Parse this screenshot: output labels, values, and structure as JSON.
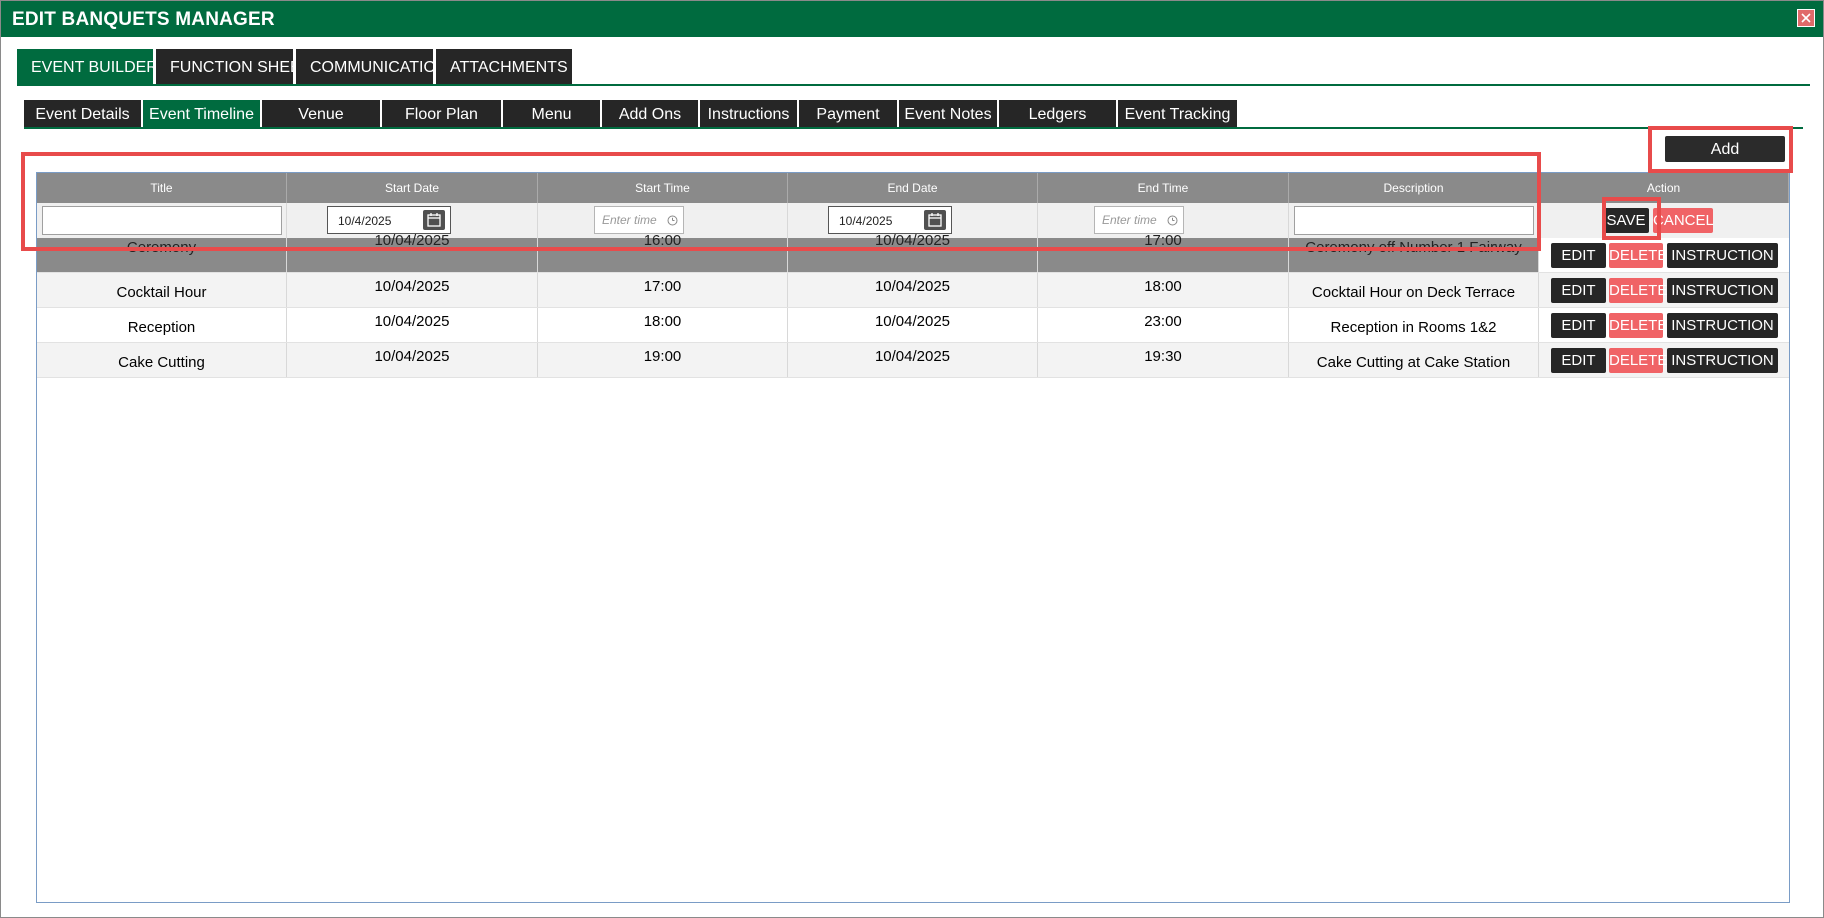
{
  "window": {
    "title": "EDIT BANQUETS MANAGER"
  },
  "main_tabs": [
    {
      "label": "EVENT BUILDER"
    },
    {
      "label": "FUNCTION SHEET"
    },
    {
      "label": "COMMUNICATION"
    },
    {
      "label": "ATTACHMENTS"
    }
  ],
  "sub_tabs": [
    {
      "label": "Event Details"
    },
    {
      "label": "Event Timeline"
    },
    {
      "label": "Venue"
    },
    {
      "label": "Floor Plan"
    },
    {
      "label": "Menu"
    },
    {
      "label": "Add Ons"
    },
    {
      "label": "Instructions"
    },
    {
      "label": "Payment"
    },
    {
      "label": "Event Notes"
    },
    {
      "label": "Ledgers"
    },
    {
      "label": "Event Tracking"
    }
  ],
  "toolbar": {
    "add_label": "Add"
  },
  "table": {
    "headers": [
      "Title",
      "Start Date",
      "Start Time",
      "End Date",
      "End Time",
      "Description",
      "Action"
    ],
    "edit_row": {
      "title_value": "",
      "start_date": "10/4/2025",
      "start_time_placeholder": "Enter time",
      "end_date": "10/4/2025",
      "end_time_placeholder": "Enter time",
      "description_value": "",
      "save_label": "SAVE",
      "cancel_label": "CANCEL"
    },
    "rows": [
      {
        "title": "Ceremony",
        "start_date": "10/04/2025",
        "start_time": "16:00",
        "end_date": "10/04/2025",
        "end_time": "17:00",
        "description": "Ceremony off Number 1 Fairway"
      },
      {
        "title": "Cocktail Hour",
        "start_date": "10/04/2025",
        "start_time": "17:00",
        "end_date": "10/04/2025",
        "end_time": "18:00",
        "description": "Cocktail Hour on Deck Terrace"
      },
      {
        "title": "Reception",
        "start_date": "10/04/2025",
        "start_time": "18:00",
        "end_date": "10/04/2025",
        "end_time": "23:00",
        "description": "Reception in Rooms 1&2"
      },
      {
        "title": "Cake Cutting",
        "start_date": "10/04/2025",
        "start_time": "19:00",
        "end_date": "10/04/2025",
        "end_time": "19:30",
        "description": "Cake Cutting at Cake Station"
      }
    ],
    "row_actions": {
      "edit_label": "EDIT",
      "delete_label": "DELETE",
      "instruction_label": "INSTRUCTION"
    }
  },
  "colors": {
    "brand_green": "#006b3f",
    "dark": "#262626",
    "danger": "#f06366",
    "highlight": "#e84b4b"
  },
  "icons": {
    "close": "close-icon",
    "calendar": "calendar-icon",
    "clock": "clock-icon"
  }
}
